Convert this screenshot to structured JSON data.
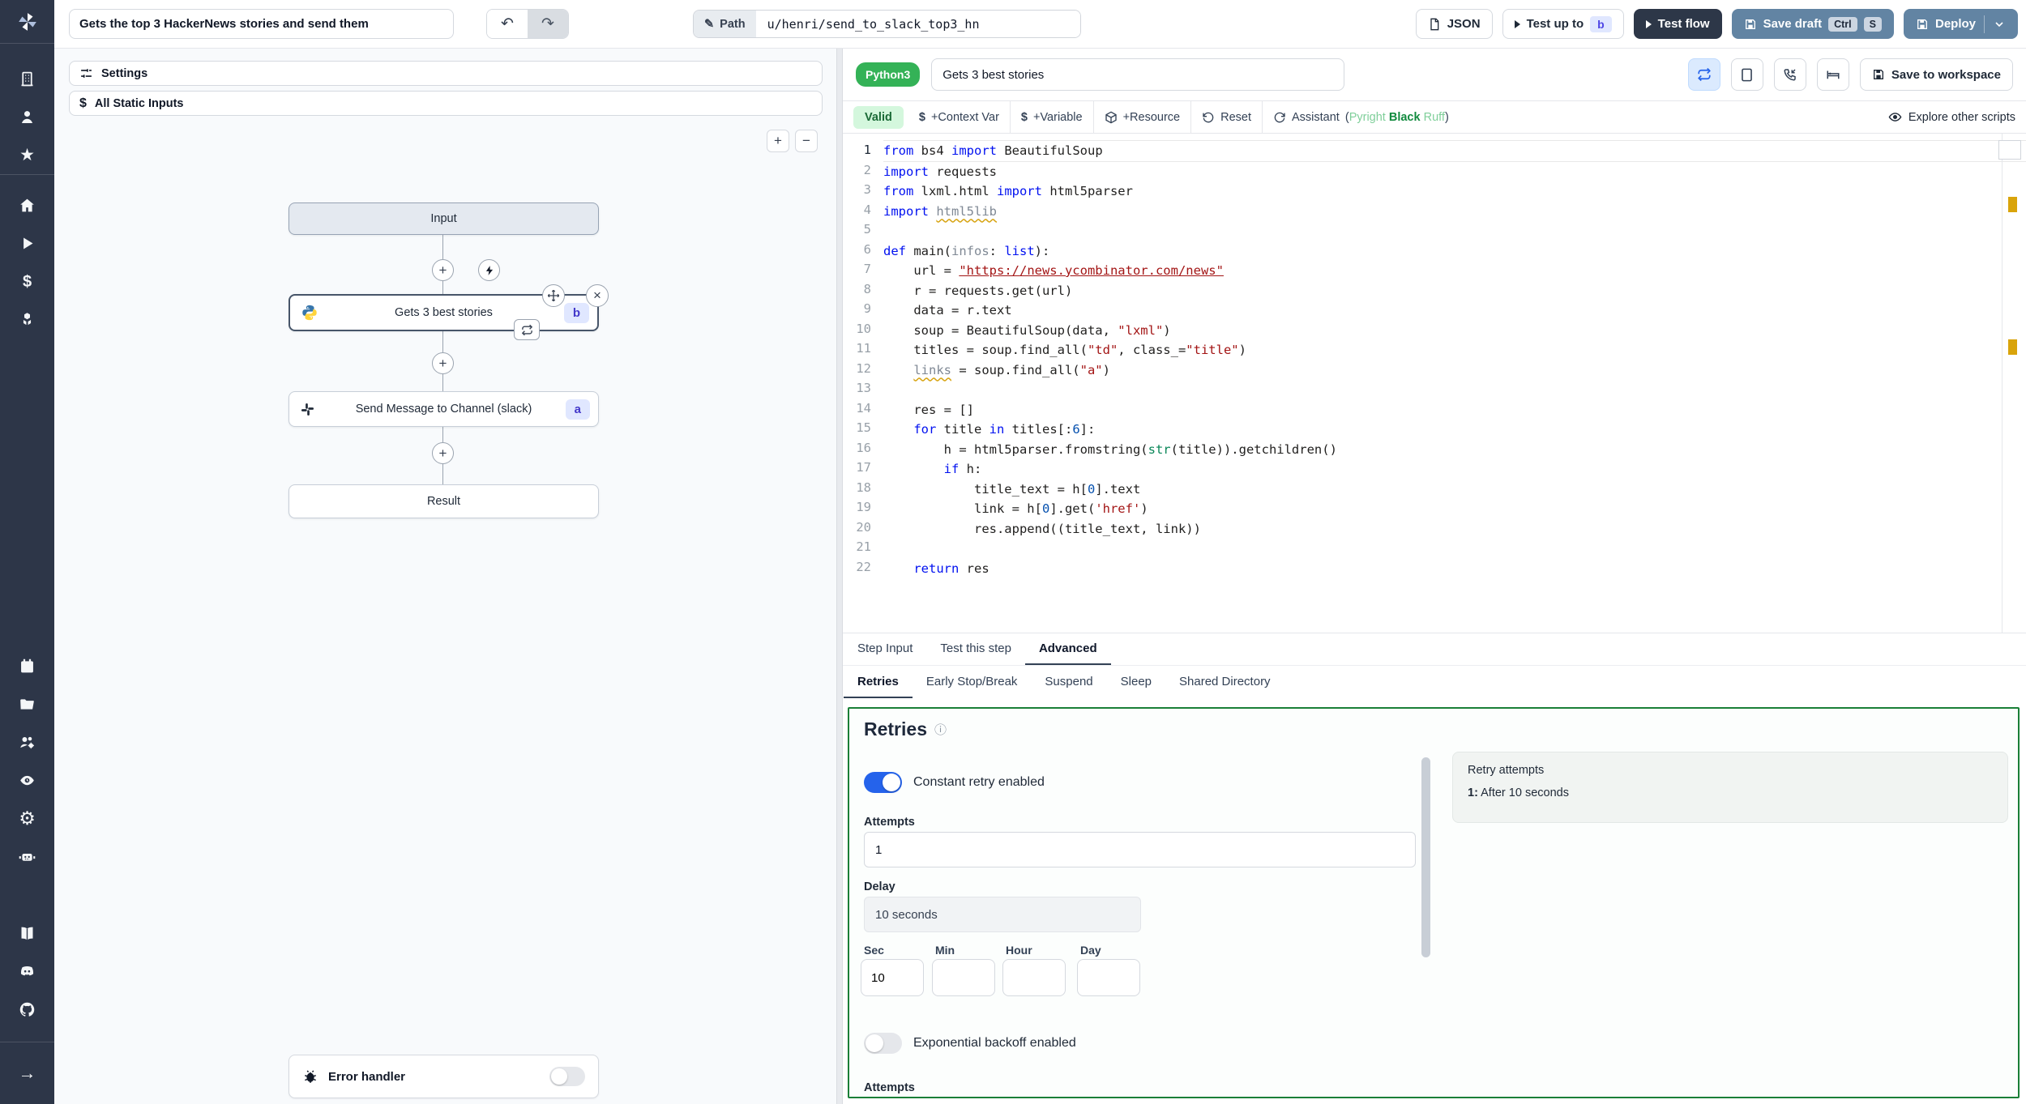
{
  "icons": {
    "undo": "↶",
    "redo": "↷",
    "pencil": "✎",
    "close": "×",
    "plus": "+",
    "minus": "−",
    "info": "ⓘ",
    "arrow_right": "→",
    "dollar": "$",
    "gear": "⚙",
    "eye": "◉",
    "star": "★",
    "home": "⌂",
    "play": "▶",
    "building": "▦",
    "boxes": "❖",
    "node_plus": "+"
  },
  "topbar": {
    "flow_title": "Gets the top 3 HackerNews stories and send them",
    "path_label": "Path",
    "path_value": "u/henri/send_to_slack_top3_hn",
    "json_button": "JSON",
    "test_up_to_label": "Test up to",
    "test_up_to_badge": "b",
    "test_flow_label": "Test flow",
    "save_draft_label": "Save draft",
    "kbd_ctrl": "Ctrl",
    "kbd_s": "S",
    "deploy_label": "Deploy"
  },
  "flow": {
    "settings_label": "Settings",
    "static_inputs_label": "All Static Inputs",
    "nodes": {
      "input_label": "Input",
      "step_b_label": "Gets 3 best stories",
      "step_b_badge": "b",
      "step_a_label": "Send Message to Channel (slack)",
      "step_a_badge": "a",
      "result_label": "Result"
    },
    "error_handler_label": "Error handler"
  },
  "editor": {
    "language_badge": "Python3",
    "step_title": "Gets 3 best stories",
    "save_to_workspace": "Save to workspace",
    "toolbar": {
      "valid": "Valid",
      "context_var": "+Context Var",
      "variable": "+Variable",
      "resource": "+Resource",
      "reset": "Reset",
      "assistant": "Assistant",
      "assistant_open": "(",
      "tool_pyright": "Pyright",
      "tool_black": "Black",
      "tool_ruff": "Ruff",
      "assistant_close": ")",
      "explore": "Explore other scripts"
    },
    "code": {
      "active_line": 1,
      "lines": [
        [
          [
            "k",
            "from"
          ],
          [
            "p",
            " bs4 "
          ],
          [
            "k",
            "import"
          ],
          [
            "p",
            " BeautifulSoup"
          ]
        ],
        [
          [
            "k",
            "import"
          ],
          [
            "p",
            " requests"
          ]
        ],
        [
          [
            "k",
            "from"
          ],
          [
            "p",
            " lxml.html "
          ],
          [
            "k",
            "import"
          ],
          [
            "p",
            " html5parser"
          ]
        ],
        [
          [
            "k",
            "import"
          ],
          [
            "p",
            " "
          ],
          [
            "uw",
            "html5lib"
          ]
        ],
        [],
        [
          [
            "k",
            "def"
          ],
          [
            "p",
            " main("
          ],
          [
            "u",
            "infos"
          ],
          [
            "p",
            ": "
          ],
          [
            "k",
            "list"
          ],
          [
            "p",
            "):"
          ]
        ],
        [
          [
            "p",
            "    url = "
          ],
          [
            "sl",
            "\"https://news.ycombinator.com/news\""
          ]
        ],
        [
          [
            "p",
            "    r = requests.get(url)"
          ]
        ],
        [
          [
            "p",
            "    data = r.text"
          ]
        ],
        [
          [
            "p",
            "    soup = BeautifulSoup(data, "
          ],
          [
            "s",
            "\"lxml\""
          ],
          [
            "p",
            ")"
          ]
        ],
        [
          [
            "p",
            "    titles = soup.find_all("
          ],
          [
            "s",
            "\"td\""
          ],
          [
            "p",
            ", class_="
          ],
          [
            "s",
            "\"title\""
          ],
          [
            "p",
            ")"
          ]
        ],
        [
          [
            "p",
            "    "
          ],
          [
            "uw",
            "links"
          ],
          [
            "p",
            " = soup.find_all("
          ],
          [
            "s",
            "\"a\""
          ],
          [
            "p",
            ")"
          ]
        ],
        [],
        [
          [
            "p",
            "    res = []"
          ]
        ],
        [
          [
            "p",
            "    "
          ],
          [
            "k",
            "for"
          ],
          [
            "p",
            " title "
          ],
          [
            "k",
            "in"
          ],
          [
            "p",
            " titles[:"
          ],
          [
            "n",
            "6"
          ],
          [
            "p",
            "]:"
          ]
        ],
        [
          [
            "p",
            "        h = html5parser.fromstring("
          ],
          [
            "g",
            "str"
          ],
          [
            "p",
            "(title)).getchildren()"
          ]
        ],
        [
          [
            "p",
            "        "
          ],
          [
            "k",
            "if"
          ],
          [
            "p",
            " h:"
          ]
        ],
        [
          [
            "p",
            "            title_text = h["
          ],
          [
            "n",
            "0"
          ],
          [
            "p",
            "].text"
          ]
        ],
        [
          [
            "p",
            "            link = h["
          ],
          [
            "n",
            "0"
          ],
          [
            "p",
            "].get("
          ],
          [
            "s",
            "'href'"
          ],
          [
            "p",
            ")"
          ]
        ],
        [
          [
            "p",
            "            res.append((title_text, link))"
          ]
        ],
        [],
        [
          [
            "p",
            "    "
          ],
          [
            "k",
            "return"
          ],
          [
            "p",
            " res"
          ]
        ]
      ]
    }
  },
  "tabs": {
    "step_input": "Step Input",
    "test_this_step": "Test this step",
    "advanced": "Advanced"
  },
  "subtabs": {
    "retries": "Retries",
    "early_stop": "Early Stop/Break",
    "suspend": "Suspend",
    "sleep": "Sleep",
    "shared_directory": "Shared Directory"
  },
  "retries": {
    "heading": "Retries",
    "constant_label": "Constant retry enabled",
    "attempts_label": "Attempts",
    "attempts_value": "1",
    "delay_label": "Delay",
    "delay_value": "10 seconds",
    "sec_label": "Sec",
    "min_label": "Min",
    "hour_label": "Hour",
    "day_label": "Day",
    "sec_value": "10",
    "min_value": "",
    "hour_value": "",
    "day_value": "",
    "exponential_label": "Exponential backoff enabled",
    "attempts2_label": "Attempts",
    "summary_title": "Retry attempts",
    "summary_index": "1:",
    "summary_text": "After 10 seconds"
  },
  "colors": {
    "accent_green": "#1a7f37",
    "toggle_on": "#2563eb",
    "badge_green": "#34b257",
    "slate_button": "#6284a3",
    "dark_button": "#2d3748"
  }
}
